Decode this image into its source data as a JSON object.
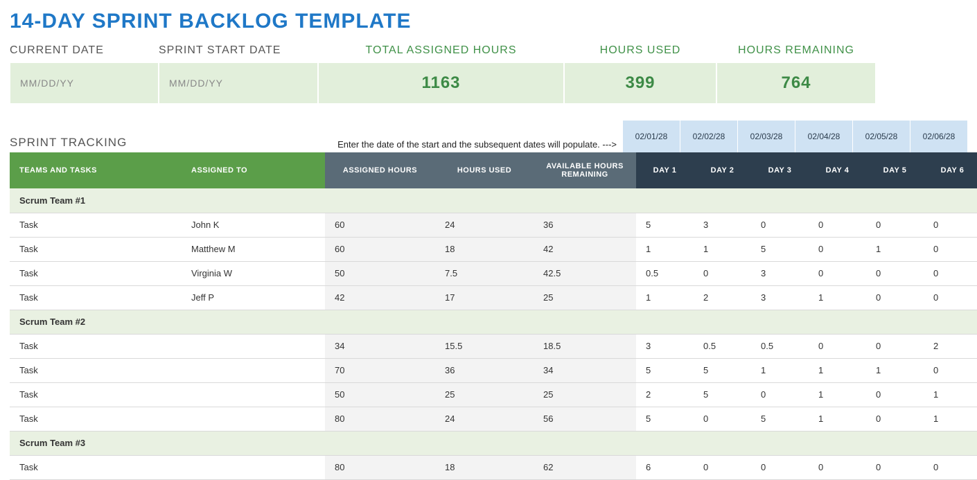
{
  "title": "14-DAY SPRINT BACKLOG TEMPLATE",
  "summary": {
    "labels": {
      "currentDate": "CURRENT DATE",
      "sprintStart": "SPRINT START DATE",
      "totalAssigned": "TOTAL ASSIGNED HOURS",
      "hoursUsed": "HOURS USED",
      "hoursRemaining": "HOURS REMAINING"
    },
    "values": {
      "currentDate": "MM/DD/YY",
      "sprintStart": "MM/DD/YY",
      "totalAssigned": "1163",
      "hoursUsed": "399",
      "hoursRemaining": "764"
    }
  },
  "tracking": {
    "section": "SPRINT TRACKING",
    "hint": "Enter the date of the start and the subsequent dates will populate.  --->",
    "dates": [
      "02/01/28",
      "02/02/28",
      "02/03/28",
      "02/04/28",
      "02/05/28",
      "02/06/28"
    ],
    "headers": {
      "teams": "TEAMS AND TASKS",
      "assignedTo": "ASSIGNED TO",
      "assignedHours": "ASSIGNED HOURS",
      "hoursUsed": "HOURS USED",
      "availRemaining": "AVAILABLE HOURS REMAINING",
      "days": [
        "DAY 1",
        "DAY 2",
        "DAY 3",
        "DAY 4",
        "DAY 5",
        "DAY 6"
      ]
    },
    "rows": [
      {
        "type": "team",
        "label": "Scrum Team #1"
      },
      {
        "type": "task",
        "label": "Task",
        "assignedTo": "John K",
        "ah": "60",
        "hu": "24",
        "ar": "36",
        "d": [
          "5",
          "3",
          "0",
          "0",
          "0",
          "0"
        ]
      },
      {
        "type": "task",
        "label": "Task",
        "assignedTo": "Matthew M",
        "ah": "60",
        "hu": "18",
        "ar": "42",
        "d": [
          "1",
          "1",
          "5",
          "0",
          "1",
          "0"
        ]
      },
      {
        "type": "task",
        "label": "Task",
        "assignedTo": "Virginia W",
        "ah": "50",
        "hu": "7.5",
        "ar": "42.5",
        "d": [
          "0.5",
          "0",
          "3",
          "0",
          "0",
          "0"
        ]
      },
      {
        "type": "task",
        "label": "Task",
        "assignedTo": "Jeff P",
        "ah": "42",
        "hu": "17",
        "ar": "25",
        "d": [
          "1",
          "2",
          "3",
          "1",
          "0",
          "0"
        ]
      },
      {
        "type": "team",
        "label": "Scrum Team #2"
      },
      {
        "type": "task",
        "label": "Task",
        "assignedTo": "",
        "ah": "34",
        "hu": "15.5",
        "ar": "18.5",
        "d": [
          "3",
          "0.5",
          "0.5",
          "0",
          "0",
          "2"
        ]
      },
      {
        "type": "task",
        "label": "Task",
        "assignedTo": "",
        "ah": "70",
        "hu": "36",
        "ar": "34",
        "d": [
          "5",
          "5",
          "1",
          "1",
          "1",
          "0"
        ]
      },
      {
        "type": "task",
        "label": "Task",
        "assignedTo": "",
        "ah": "50",
        "hu": "25",
        "ar": "25",
        "d": [
          "2",
          "5",
          "0",
          "1",
          "0",
          "1"
        ]
      },
      {
        "type": "task",
        "label": "Task",
        "assignedTo": "",
        "ah": "80",
        "hu": "24",
        "ar": "56",
        "d": [
          "5",
          "0",
          "5",
          "1",
          "0",
          "1"
        ]
      },
      {
        "type": "team",
        "label": "Scrum Team #3"
      },
      {
        "type": "task",
        "label": "Task",
        "assignedTo": "",
        "ah": "80",
        "hu": "18",
        "ar": "62",
        "d": [
          "6",
          "0",
          "0",
          "0",
          "0",
          "0"
        ]
      }
    ]
  }
}
